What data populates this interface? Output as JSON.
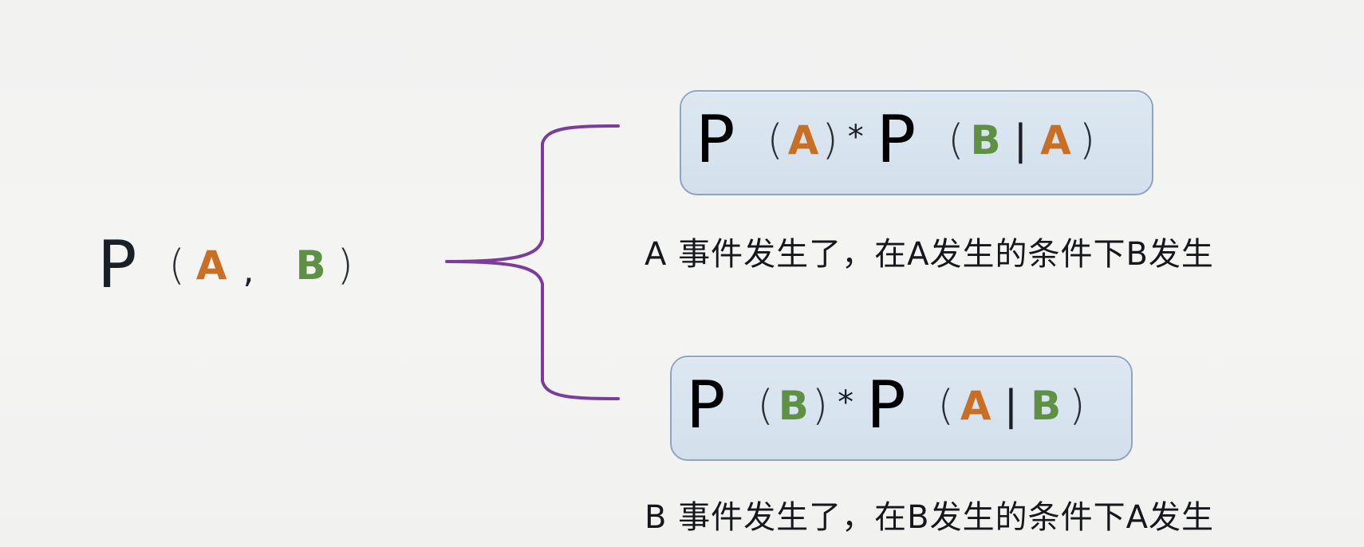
{
  "colors": {
    "event_a": "#c96f25",
    "event_b": "#5f9145",
    "brace": "#7b3d9b",
    "box_fill": "#d8e4ef",
    "box_border": "#8ea4c2",
    "text": "#1b1f28"
  },
  "left": {
    "P": "P",
    "open": "(",
    "a": "A",
    "comma": ",",
    "b": "B",
    "close": ")"
  },
  "top_formula": {
    "P1": "P",
    "open1": "(",
    "x1": "A",
    "close1": ")",
    "op": "*",
    "P2": "P",
    "open2": "(",
    "x2": "B",
    "bar": "|",
    "x3": "A",
    "close2": ")",
    "caption": "A 事件发生了，在A发生的条件下B发生"
  },
  "bottom_formula": {
    "P1": "P",
    "open1": "(",
    "x1": "B",
    "close1": ")",
    "op": "*",
    "P2": "P",
    "open2": "(",
    "x2": "A",
    "bar": "|",
    "x3": "B",
    "close2": ")",
    "caption": "B 事件发生了，在B发生的条件下A发生"
  }
}
